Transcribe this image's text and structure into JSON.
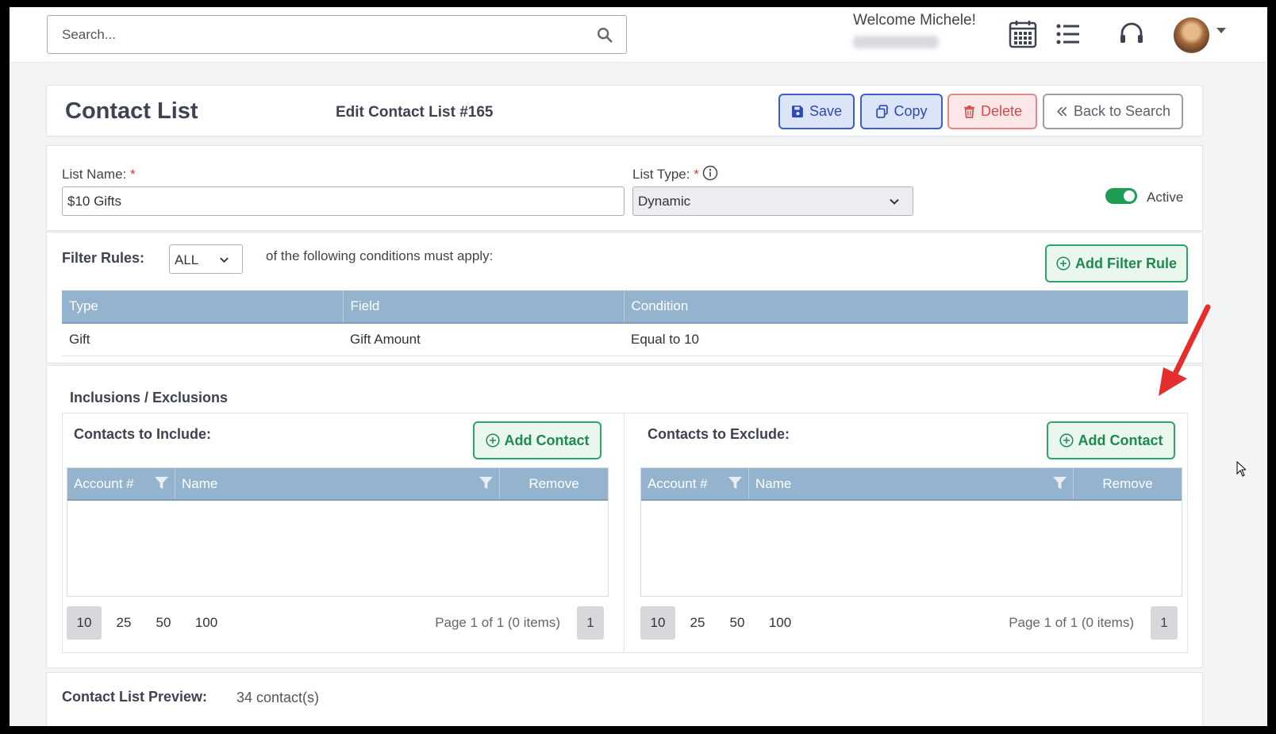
{
  "topbar": {
    "search_placeholder": "Search...",
    "welcome": "Welcome Michele!",
    "icons": [
      "search-icon",
      "calendar-icon",
      "list-icon",
      "headset-icon",
      "avatar",
      "caret-down-icon"
    ]
  },
  "header": {
    "title": "Contact List",
    "subtitle": "Edit Contact List #165",
    "buttons": {
      "save": "Save",
      "copy": "Copy",
      "delete": "Delete",
      "back": "Back to Search"
    }
  },
  "form": {
    "list_name_label": "List Name:",
    "list_name_value": "$10 Gifts",
    "list_type_label": "List Type:",
    "list_type_value": "Dynamic",
    "required_mark": "*",
    "active_label": "Active",
    "active": true
  },
  "filter": {
    "label": "Filter Rules:",
    "match_value": "ALL",
    "conditions_text": "of the following conditions must apply:",
    "add_rule_label": "Add Filter Rule",
    "columns": [
      "Type",
      "Field",
      "Condition"
    ],
    "rows": [
      {
        "type": "Gift",
        "field": "Gift Amount",
        "condition": "Equal to 10"
      }
    ]
  },
  "inclusions": {
    "title": "Inclusions / Exclusions",
    "include": {
      "title": "Contacts to Include:",
      "add_label": "Add Contact",
      "columns": {
        "account": "Account #",
        "name": "Name",
        "remove": "Remove"
      },
      "page_sizes": [
        "10",
        "25",
        "50",
        "100"
      ],
      "page_info": "Page 1 of 1 (0 items)",
      "page_number": "1"
    },
    "exclude": {
      "title": "Contacts to Exclude:",
      "add_label": "Add Contact",
      "columns": {
        "account": "Account #",
        "name": "Name",
        "remove": "Remove"
      },
      "page_sizes": [
        "10",
        "25",
        "50",
        "100"
      ],
      "page_info": "Page 1 of 1 (0 items)",
      "page_number": "1"
    }
  },
  "preview": {
    "label": "Contact List Preview:",
    "value": "34 contact(s)"
  },
  "colors": {
    "primary": "#3f5ec9",
    "danger": "#d24b4b",
    "success": "#2ea36a",
    "table_header": "#93b3ce",
    "annotation_arrow": "#e52d2d"
  }
}
